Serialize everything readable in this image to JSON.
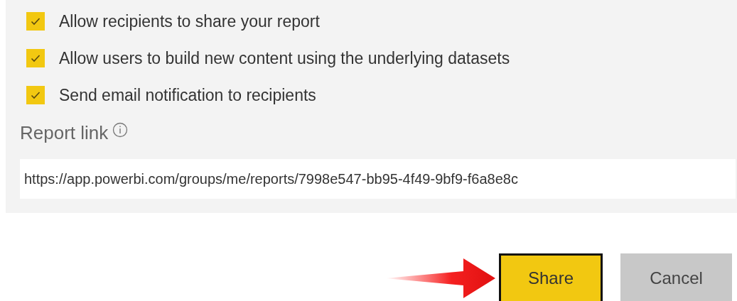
{
  "options": [
    {
      "label": "Allow recipients to share your report",
      "checked": true
    },
    {
      "label": "Allow users to build new content using the underlying datasets",
      "checked": true
    },
    {
      "label": "Send email notification to recipients",
      "checked": true
    }
  ],
  "report_link": {
    "label": "Report link",
    "value": "https://app.powerbi.com/groups/me/reports/7998e547-bb95-4f49-9bf9-f6a8e8c"
  },
  "buttons": [
    {
      "label": "Share",
      "kind": "primary"
    },
    {
      "label": "Cancel",
      "kind": "secondary"
    }
  ]
}
